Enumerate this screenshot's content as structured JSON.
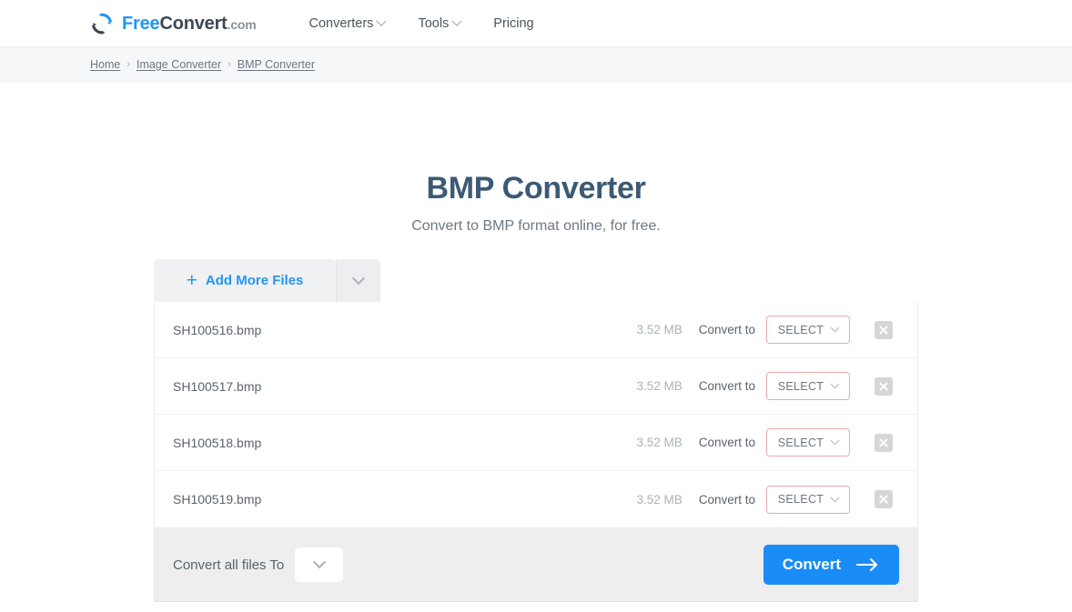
{
  "header": {
    "logo": {
      "icon": "convert-circular-arrows-icon",
      "free": "Free",
      "convert": "Convert",
      "dotcom": ".com"
    },
    "nav": [
      {
        "label": "Converters",
        "has_caret": true
      },
      {
        "label": "Tools",
        "has_caret": true
      },
      {
        "label": "Pricing",
        "has_caret": false
      }
    ]
  },
  "breadcrumb": {
    "separator": "›",
    "items": [
      "Home",
      "Image Converter",
      "BMP Converter"
    ]
  },
  "main": {
    "title": "BMP Converter",
    "subtitle": "Convert to BMP format online, for free."
  },
  "converter": {
    "add_more_files": {
      "plus": "+",
      "label": "Add More Files",
      "dropdown_icon": "chevron-down-icon"
    },
    "rows": [
      {
        "name": "SH100516.bmp",
        "size": "3.52 MB",
        "convert_to": "Convert to",
        "select_label": "SELECT"
      },
      {
        "name": "SH100517.bmp",
        "size": "3.52 MB",
        "convert_to": "Convert to",
        "select_label": "SELECT"
      },
      {
        "name": "SH100518.bmp",
        "size": "3.52 MB",
        "convert_to": "Convert to",
        "select_label": "SELECT"
      },
      {
        "name": "SH100519.bmp",
        "size": "3.52 MB",
        "convert_to": "Convert to",
        "select_label": "SELECT"
      }
    ],
    "action_bar": {
      "convert_all_label": "Convert all files To",
      "convert_all_value": "",
      "convert_button": "Convert",
      "convert_button_icon": "arrow-right-icon"
    }
  },
  "colors": {
    "brand_blue": "#2196f3",
    "convert_button_blue": "#1a8cf5",
    "title_slate": "#3d5a73",
    "select_border_pink": "#eaa9a9",
    "bar_gray": "#eeeeef"
  }
}
